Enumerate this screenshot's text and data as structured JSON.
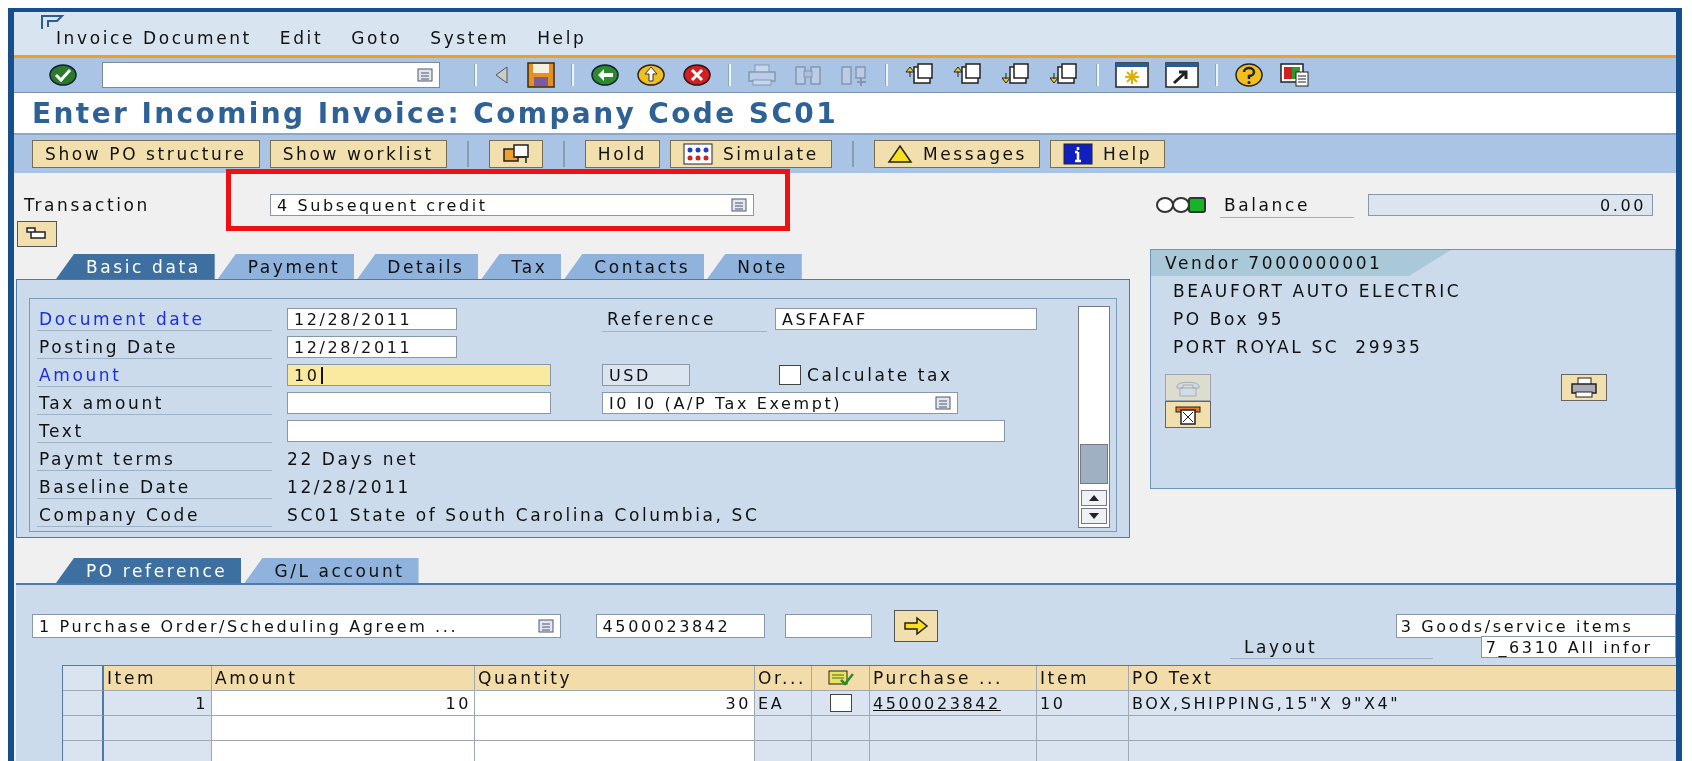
{
  "menu_bar": {
    "items": [
      "Invoice Document",
      "Edit",
      "Goto",
      "System",
      "Help"
    ]
  },
  "toolbar": {
    "groups": [
      [
        {
          "kind": "enter",
          "disabled": false
        }
      ],
      [
        {
          "kind": "triangle",
          "disabled": false
        },
        {
          "kind": "save",
          "disabled": false
        }
      ],
      [
        {
          "kind": "back",
          "disabled": false
        },
        {
          "kind": "exit",
          "disabled": false
        },
        {
          "kind": "cancel",
          "disabled": false
        }
      ],
      [
        {
          "kind": "print",
          "disabled": true
        },
        {
          "kind": "find",
          "disabled": true
        },
        {
          "kind": "find_next",
          "disabled": true
        }
      ],
      [
        {
          "kind": "first_page",
          "disabled": false
        },
        {
          "kind": "previous_page",
          "disabled": false
        },
        {
          "kind": "next_page",
          "disabled": false
        },
        {
          "kind": "last_page",
          "disabled": false
        }
      ],
      [
        {
          "kind": "new_session",
          "disabled": false
        },
        {
          "kind": "shortcut",
          "disabled": false
        }
      ],
      [
        {
          "kind": "help",
          "disabled": false
        },
        {
          "kind": "layout",
          "disabled": false
        }
      ]
    ]
  },
  "title": "Enter Incoming Invoice: Company Code SC01",
  "app_toolbar": {
    "groups": [
      [
        {
          "kind": "text",
          "label": "Show PO structure"
        },
        {
          "kind": "text",
          "label": "Show worklist"
        }
      ],
      [
        {
          "kind": "structure"
        }
      ],
      [
        {
          "kind": "text",
          "label": "Hold"
        },
        {
          "kind": "simulate",
          "label": "Simulate"
        }
      ],
      [
        {
          "kind": "warning",
          "label": "Messages"
        },
        {
          "kind": "info",
          "label": "Help"
        }
      ]
    ]
  },
  "transaction": {
    "label": "Transaction",
    "value": "4 Subsequent credit",
    "highlighted": true
  },
  "balance": {
    "lights": [
      {
        "on": false
      },
      {
        "on": false
      },
      {
        "on": true
      }
    ],
    "label": "Balance",
    "value": "0.00"
  },
  "tabs": [
    {
      "label": "Basic data",
      "selected": true
    },
    {
      "label": "Payment",
      "selected": false
    },
    {
      "label": "Details",
      "selected": false
    },
    {
      "label": "Tax",
      "selected": false
    },
    {
      "label": "Contacts",
      "selected": false
    },
    {
      "label": "Note",
      "selected": false
    }
  ],
  "basic_data": {
    "document_date": {
      "label": "Document date",
      "required": true,
      "value": "12/28/2011"
    },
    "posting_date": {
      "label": "Posting Date",
      "required": false,
      "value": "12/28/2011"
    },
    "amount": {
      "label": "Amount",
      "required": true,
      "value": "10",
      "focused": true
    },
    "tax_amount": {
      "label": "Tax amount",
      "required": false
    },
    "text": {
      "label": "Text",
      "required": false
    },
    "payment_terms": {
      "label": "Paymt terms",
      "required": false,
      "value": "22 Days net"
    },
    "baseline_date": {
      "label": "Baseline Date",
      "required": false,
      "value": "12/28/2011"
    },
    "company_code": {
      "label": "Company Code",
      "required": false,
      "value": "SC01 State of South Carolina Columbia, SC"
    },
    "reference": {
      "label": "Reference",
      "value": "ASFAFAF"
    },
    "currency": "USD",
    "calculate_tax": {
      "label": "Calculate tax",
      "checked": false
    },
    "tax_code": "I0 I0 (A/P Tax Exempt)"
  },
  "vendor": {
    "title": "Vendor 7000000001",
    "lines": [
      "BEAUFORT AUTO ELECTRIC",
      "PO Box 95",
      "PORT ROYAL SC  29935"
    ],
    "buttons": [
      {
        "kind": "phone",
        "disabled": true
      },
      {
        "kind": "fax",
        "disabled": false
      },
      {
        "kind": "print",
        "disabled": false
      }
    ]
  },
  "po_tabs": [
    {
      "label": "PO reference",
      "selected": true
    },
    {
      "label": "G/L account",
      "selected": false
    }
  ],
  "po_reference": {
    "document_type": "1 Purchase Order/Scheduling Agreem ...",
    "po_number": "4500023842",
    "item_selection": "3 Goods/service items",
    "layout": {
      "label": "Layout",
      "value": "7_6310 All infor"
    }
  },
  "table": {
    "columns": [
      {
        "kind": "text",
        "label": "Item"
      },
      {
        "kind": "text",
        "label": "Amount"
      },
      {
        "kind": "text",
        "label": "Quantity"
      },
      {
        "kind": "text",
        "label": "Or..."
      },
      {
        "kind": "icon"
      },
      {
        "kind": "text",
        "label": "Purchase ..."
      },
      {
        "kind": "text",
        "label": "Item"
      },
      {
        "kind": "text",
        "label": "PO Text"
      }
    ],
    "rows": [
      {
        "item": "1",
        "amount": "10",
        "quantity": "30",
        "order_unit": "EA",
        "checked": false,
        "po_number": "4500023842",
        "po_item": "10",
        "po_text": "BOX,SHIPPING,15\"X 9\"X4\""
      }
    ]
  }
}
